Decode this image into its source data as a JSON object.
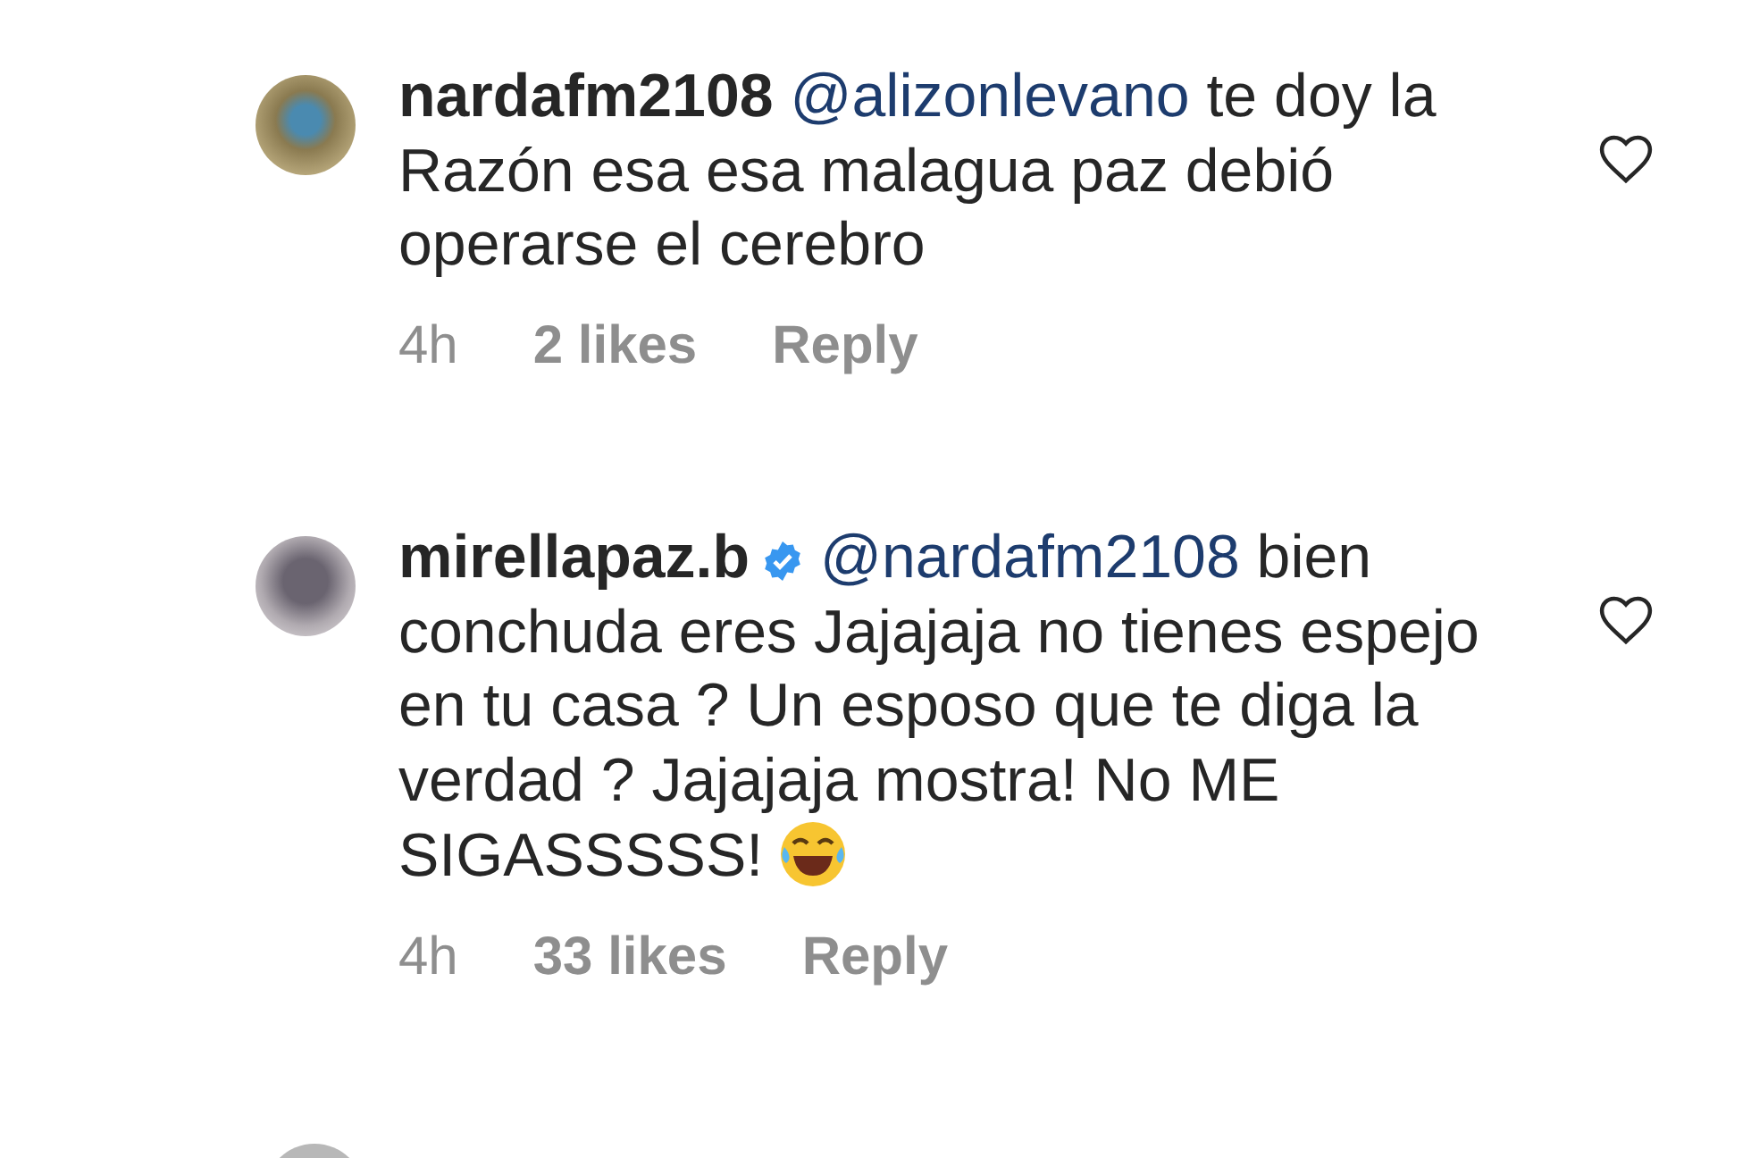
{
  "comments": [
    {
      "username": "nardafm2108",
      "verified": false,
      "mention": "@alizonlevano",
      "text": "te doy la Razón esa esa malagua paz debió operarse el cerebro",
      "laughing_emoji": false,
      "time": "4h",
      "likes": "2 likes",
      "reply": "Reply",
      "liked": false
    },
    {
      "username": "mirellapaz.b",
      "verified": true,
      "mention": "@nardafm2108",
      "text": "bien conchuda eres Jajajaja no tienes espejo en tu casa ? Un esposo que te diga la verdad ? Jajajaja mostra! No ME SIGASSSSS!",
      "laughing_emoji": true,
      "time": "4h",
      "likes": "33 likes",
      "reply": "Reply",
      "liked": false
    }
  ]
}
